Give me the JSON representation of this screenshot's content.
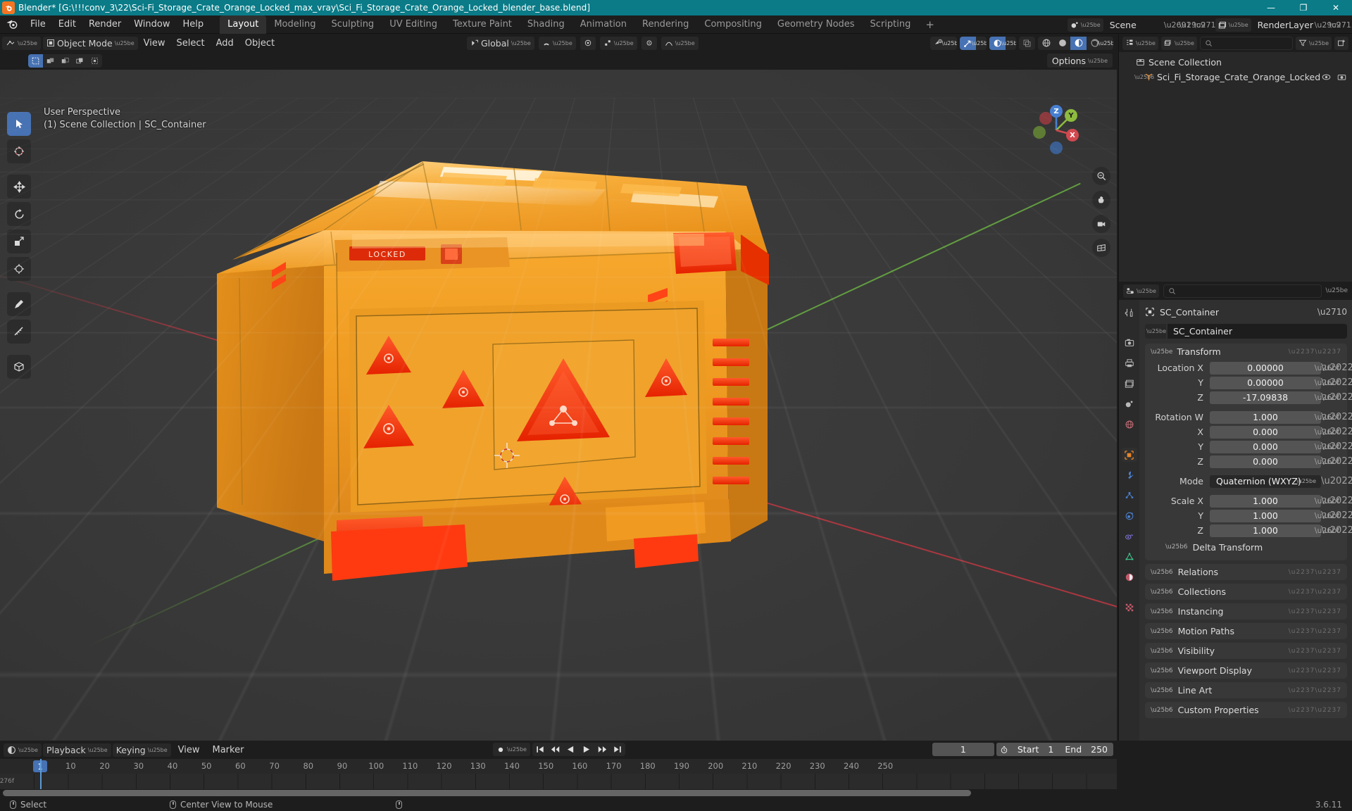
{
  "titlebar": {
    "app_icon": "blender-icon",
    "title": "Blender* [G:\\!!!conv_3\\22\\Sci-Fi_Storage_Crate_Orange_Locked_max_vray\\Sci_Fi_Storage_Crate_Orange_Locked_blender_base.blend]",
    "minimize": "—",
    "maximize": "❐",
    "close": "✕",
    "bg_color": "#0a7b87"
  },
  "topbar": {
    "menus": [
      "File",
      "Edit",
      "Render",
      "Window",
      "Help"
    ],
    "workspaces": [
      {
        "label": "Layout",
        "active": true
      },
      {
        "label": "Modeling",
        "active": false
      },
      {
        "label": "Sculpting",
        "active": false
      },
      {
        "label": "UV Editing",
        "active": false
      },
      {
        "label": "Texture Paint",
        "active": false
      },
      {
        "label": "Shading",
        "active": false
      },
      {
        "label": "Animation",
        "active": false
      },
      {
        "label": "Rendering",
        "active": false
      },
      {
        "label": "Compositing",
        "active": false
      },
      {
        "label": "Geometry Nodes",
        "active": false
      },
      {
        "label": "Scripting",
        "active": false
      }
    ],
    "add_workspace": "+",
    "scene_name": "Scene",
    "view_layer_name": "RenderLayer",
    "new_scene_icon": "copy-icon",
    "remove_scene_icon": "x-icon",
    "pin_icon": "pin-icon"
  },
  "viewport": {
    "mode": "Object Mode",
    "menus": [
      "View",
      "Select",
      "Add",
      "Object"
    ],
    "transform_orientation": "Global",
    "options_label": "Options",
    "overlay_line1": "User Perspective",
    "overlay_line2": "(1) Scene Collection | SC_Container",
    "select_modes": [
      "tweak",
      "box-select",
      "circle-select",
      "lasso-select",
      "select-box-extend"
    ],
    "gizmo_axes": [
      {
        "label": "Z",
        "color": "#477fd0"
      },
      {
        "label": "Y",
        "color": "#8dbb3e"
      },
      {
        "label": "X",
        "color": "#d1484f"
      }
    ],
    "side_buttons": [
      "zoom-icon",
      "hand-pan-icon",
      "camera-view-icon",
      "ortho-persp-toggle-icon"
    ],
    "tools": [
      {
        "name": "tweak-tool",
        "glyph": "➤",
        "active": true
      },
      {
        "name": "cursor-tool",
        "glyph": "⊕",
        "active": false
      },
      {
        "name": "move-tool",
        "glyph": "✥",
        "active": false
      },
      {
        "name": "rotate-tool",
        "glyph": "⟳",
        "active": false
      },
      {
        "name": "scale-tool",
        "glyph": "◰",
        "active": false
      },
      {
        "name": "transform-tool",
        "glyph": "✣",
        "active": false
      },
      {
        "name": "annotate-tool",
        "glyph": "✎",
        "active": false
      },
      {
        "name": "measure-tool",
        "glyph": "↗",
        "active": false
      },
      {
        "name": "add-cube-tool",
        "glyph": "⬡",
        "active": false
      }
    ],
    "shading_modes": [
      "wireframe",
      "solid",
      "material-preview",
      "rendered"
    ],
    "active_shading": "material-preview",
    "object_name": "SC_Container"
  },
  "outliner": {
    "display_mode": "view-layer-icon",
    "filter_icon": "filter-icon",
    "new_collection_icon": "new-collection-icon",
    "search_placeholder": "",
    "rows": [
      {
        "label": "Scene Collection",
        "icon": "collection-icon",
        "indent": 0,
        "expandable": false,
        "visible_icons": []
      },
      {
        "label": "Sci_Fi_Storage_Crate_Orange_Locked",
        "icon": "empty-axis-icon",
        "indent": 1,
        "expandable": true,
        "visible_icons": [
          "eye-icon",
          "camera-icon"
        ]
      }
    ]
  },
  "properties": {
    "search_placeholder": "",
    "tabs": [
      {
        "name": "tool",
        "glyph": "🔧",
        "active": false
      },
      {
        "name": "render",
        "glyph": "📷",
        "active": false
      },
      {
        "name": "output",
        "glyph": "🖨",
        "active": false
      },
      {
        "name": "view-layer",
        "glyph": "🖼",
        "active": false
      },
      {
        "name": "scene",
        "glyph": "◑",
        "active": false
      },
      {
        "name": "world",
        "glyph": "🌐",
        "active": false
      },
      {
        "name": "object",
        "glyph": "▣",
        "active": true
      },
      {
        "name": "modifiers",
        "glyph": "🔧",
        "active": false
      },
      {
        "name": "particles",
        "glyph": "⁂",
        "active": false
      },
      {
        "name": "physics",
        "glyph": "◌",
        "active": false
      },
      {
        "name": "constraints",
        "glyph": "⛓",
        "active": false
      },
      {
        "name": "data",
        "glyph": "▽",
        "active": false
      },
      {
        "name": "material",
        "glyph": "◔",
        "active": false
      },
      {
        "name": "texture",
        "glyph": "▓",
        "active": false
      }
    ],
    "breadcrumb": "SC_Container",
    "object_name": "SC_Container",
    "pin_icon": "pin-icon",
    "transform": {
      "title": "Transform",
      "location": {
        "label": "Location X",
        "x": "0.00000",
        "y": "0.00000",
        "z": "-17.09838"
      },
      "rotation": {
        "label": "Rotation W",
        "w": "1.000",
        "x": "0.000",
        "y": "0.000",
        "z": "0.000"
      },
      "mode_label": "Mode",
      "mode_value": "Quaternion (WXYZ)",
      "scale": {
        "label": "Scale X",
        "x": "1.000",
        "y": "1.000",
        "z": "1.000"
      },
      "axis_labels": {
        "x": "X",
        "y": "Y",
        "z": "Z"
      },
      "delta_transform": "Delta Transform"
    },
    "closed_panels": [
      "Relations",
      "Collections",
      "Instancing",
      "Motion Paths",
      "Visibility",
      "Viewport Display",
      "Line Art",
      "Custom Properties"
    ]
  },
  "timeline": {
    "editor_icon": "timeline-icon",
    "menus": [
      "Playback",
      "Keying",
      "View",
      "Marker"
    ],
    "auto_key_icon": "record-icon",
    "playback_buttons": [
      "jump-start",
      "prev-keyframe",
      "play-reverse",
      "play",
      "next-keyframe",
      "jump-end"
    ],
    "current_frame": "1",
    "start_label": "Start",
    "start_value": "1",
    "end_label": "End",
    "end_value": "250",
    "ticks": [
      1,
      10,
      20,
      30,
      40,
      50,
      60,
      70,
      80,
      90,
      100,
      110,
      120,
      130,
      140,
      150,
      160,
      170,
      180,
      190,
      200,
      210,
      220,
      230,
      240,
      250
    ],
    "playhead_frame": 1
  },
  "statusbar": {
    "items": [
      {
        "icon": "mouse-left-icon",
        "label": "Select"
      },
      {
        "icon": "mouse-middle-icon",
        "label": "Center View to Mouse"
      },
      {
        "icon": "mouse-right-icon",
        "label": ""
      }
    ],
    "version": "3.6.11"
  },
  "colors": {
    "accent_blue": "#4772b3",
    "crate_orange": "#f09a22",
    "crate_red": "#ff3b16",
    "header_dark": "#1d1d1d",
    "panel_bg": "#303030",
    "viewport_bg": "#393939",
    "title_teal": "#0a7b87"
  }
}
